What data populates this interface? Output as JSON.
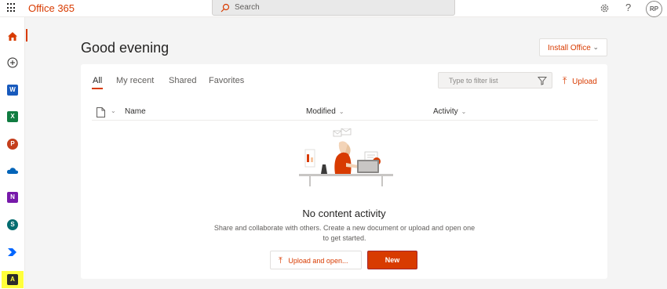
{
  "header": {
    "brand": "Office 365",
    "search_placeholder": "Search",
    "help_glyph": "?",
    "avatar_initials": "RP"
  },
  "rail": {
    "items": [
      {
        "name": "home",
        "icon": "home-icon"
      },
      {
        "name": "create",
        "icon": "plus-circle-icon"
      },
      {
        "name": "word",
        "icon": "word-icon",
        "letter": "W",
        "color": "#185abd"
      },
      {
        "name": "excel",
        "icon": "excel-icon",
        "letter": "X",
        "color": "#107c41"
      },
      {
        "name": "powerpoint",
        "icon": "powerpoint-icon",
        "letter": "P",
        "color": "#c43e1c"
      },
      {
        "name": "onedrive",
        "icon": "onedrive-icon"
      },
      {
        "name": "onenote",
        "icon": "onenote-icon",
        "letter": "N",
        "color": "#7719aa"
      },
      {
        "name": "sharepoint",
        "icon": "sharepoint-icon",
        "letter": "S",
        "color": "#036c70"
      },
      {
        "name": "power-automate",
        "icon": "power-automate-icon"
      },
      {
        "name": "all-apps",
        "icon": "apps-icon",
        "letter": "A",
        "color": "#0f0f0f"
      }
    ]
  },
  "main": {
    "greeting": "Good evening",
    "install_label": "Install Office",
    "tabs": [
      {
        "label": "All",
        "active": true
      },
      {
        "label": "My recent",
        "active": false
      },
      {
        "label": "Shared",
        "active": false
      },
      {
        "label": "Favorites",
        "active": false
      }
    ],
    "filter_placeholder": "Type to filter list",
    "upload_label": "Upload",
    "columns": {
      "name": "Name",
      "modified": "Modified",
      "activity": "Activity"
    },
    "empty": {
      "title": "No content activity",
      "description": "Share and collaborate with others. Create a new document or upload and open one to get started."
    },
    "buttons": {
      "upload_open": "Upload and open...",
      "new": "New"
    }
  },
  "colors": {
    "accent": "#d83b01",
    "highlight": "#ffff3b"
  }
}
